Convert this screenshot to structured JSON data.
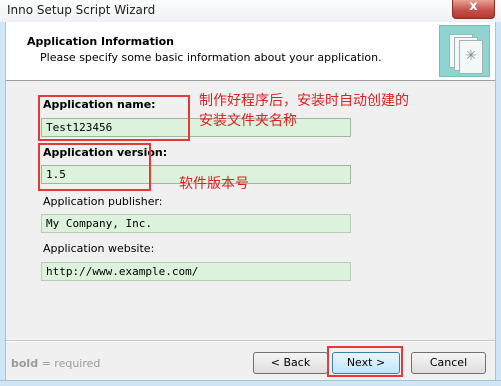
{
  "window": {
    "title": "Inno Setup Script Wizard",
    "close_glyph": "x"
  },
  "header": {
    "title": "Application Information",
    "subtitle": "Please specify some basic information about your application.",
    "logo_icon": "wizard-pages-icon"
  },
  "form": {
    "app_name": {
      "label": "Application name:",
      "value": "Test123456"
    },
    "app_version": {
      "label": "Application version:",
      "value": "1.5"
    },
    "app_publisher": {
      "label": "Application publisher:",
      "value": "My Company, Inc."
    },
    "app_website": {
      "label": "Application website:",
      "value": "http://www.example.com/"
    }
  },
  "annotations": {
    "name_note_line1": "制作好程序后，安装时自动创建的",
    "name_note_line2": "安装文件夹名称",
    "version_note": "软件版本号",
    "color": "#e53935"
  },
  "footer": {
    "hint_bold": "bold",
    "hint_rest": " = required",
    "back_label": "< Back",
    "next_label": "Next >",
    "cancel_label": "Cancel"
  }
}
